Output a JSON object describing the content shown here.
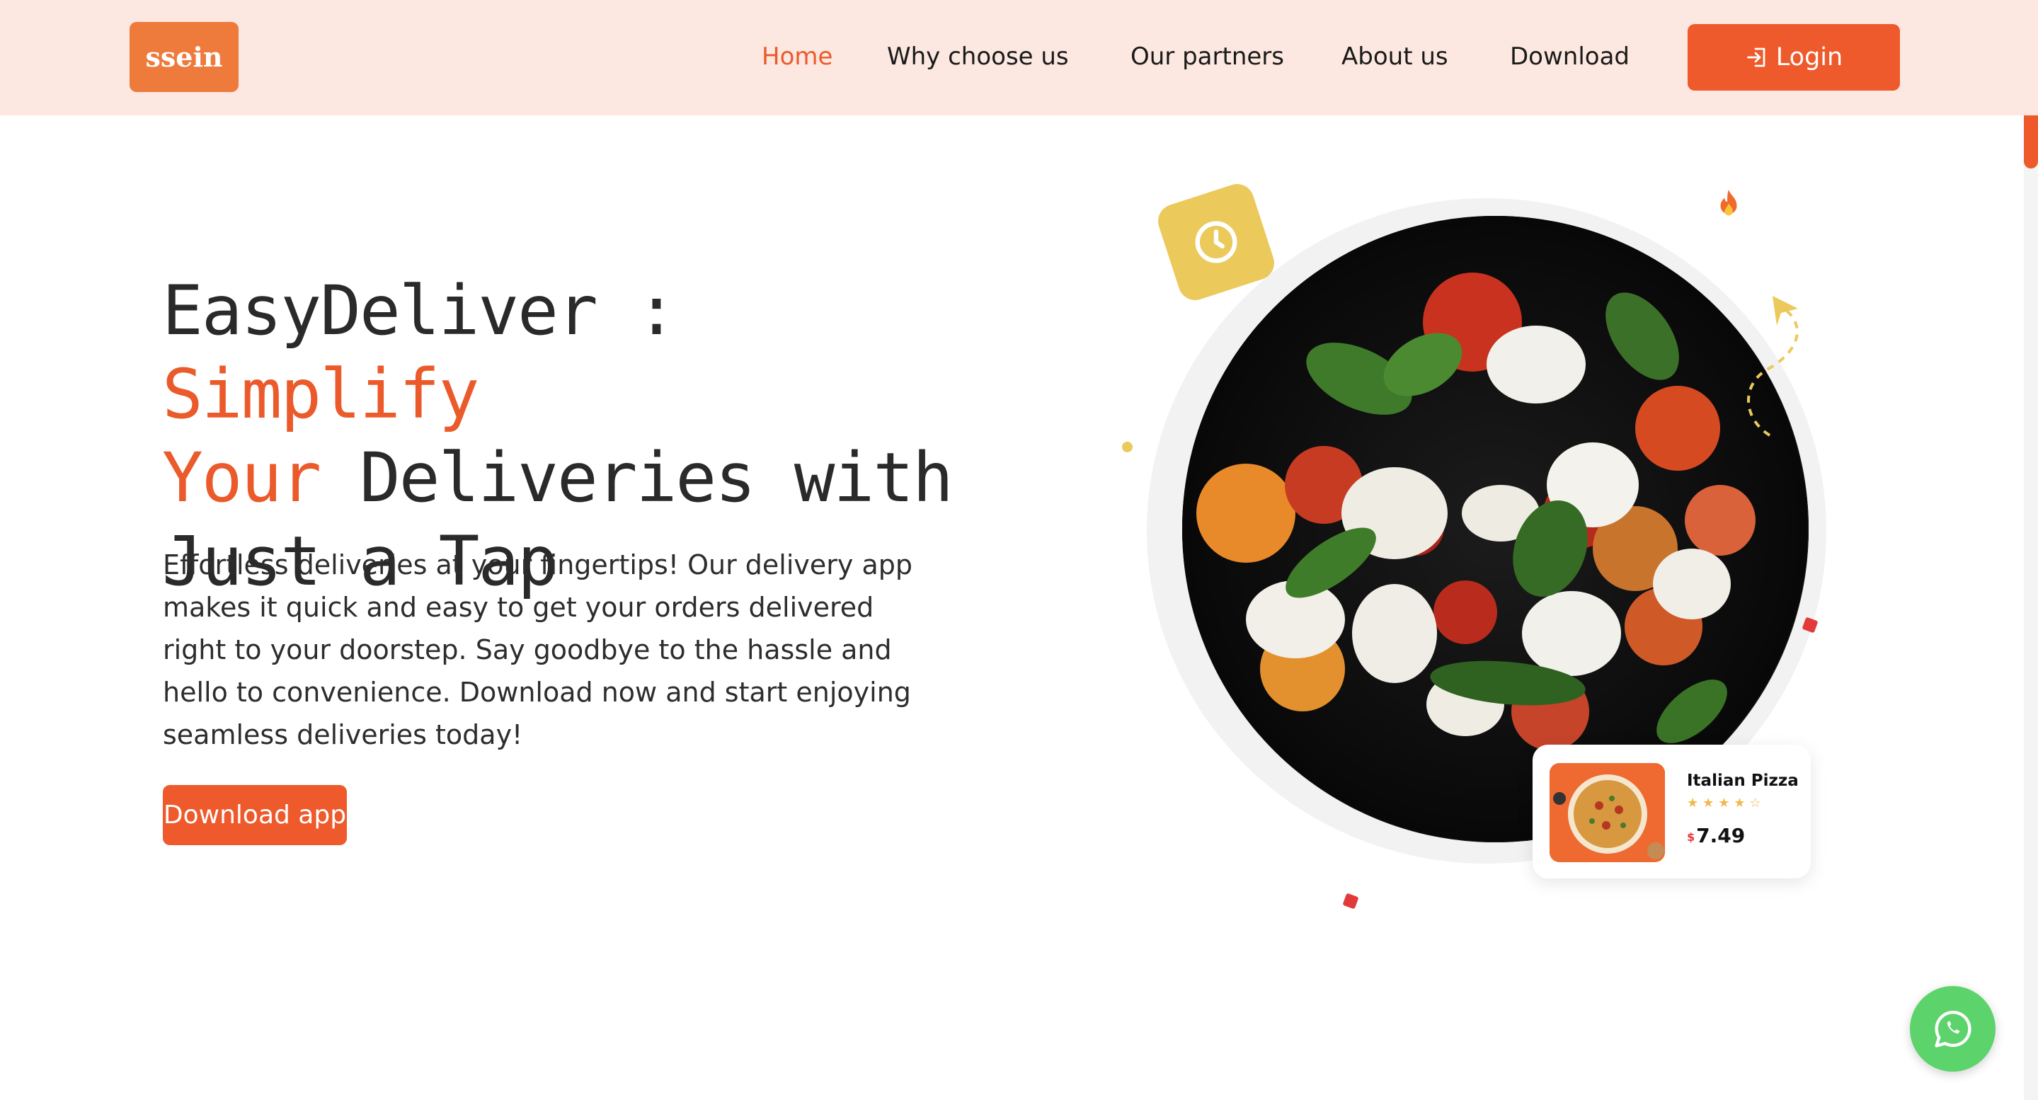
{
  "logo": {
    "text": "ssein"
  },
  "nav": {
    "items": [
      {
        "label": "Home",
        "active": true
      },
      {
        "label": "Why choose us"
      },
      {
        "label": "Our partners"
      },
      {
        "label": "About us"
      },
      {
        "label": "Download"
      }
    ],
    "login_label": "Login",
    "login_icon": "login-arrow-icon"
  },
  "hero": {
    "title_part1": "EasyDeliver : ",
    "title_accent1": "Simplify",
    "title_accent2": "Your",
    "title_part2": " Deliveries with",
    "title_part3": "Just a Tap",
    "description": "Effortless deliveries at your fingertips! Our delivery app makes it quick and easy to get your orders delivered right to your doorstep. Say goodbye to the hassle and hello to convenience. Download now and start enjoying seamless deliveries today!",
    "button_label": "Download app"
  },
  "food_card": {
    "title": "Italian Pizza",
    "stars": "★★★★☆",
    "rating": 4,
    "currency": "$",
    "price": "7.49"
  },
  "colors": {
    "accent": "#eb5a2b",
    "nav_bg": "#fce8e0",
    "clock_tile": "#ebc95a",
    "whatsapp": "#5dd36c"
  },
  "icons": [
    "clock-icon",
    "fire-icon",
    "paper-plane-icon",
    "whatsapp-icon"
  ]
}
